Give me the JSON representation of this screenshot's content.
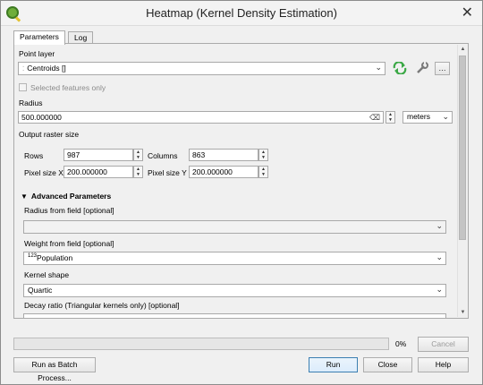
{
  "window": {
    "title": "Heatmap (Kernel Density Estimation)"
  },
  "tabs": [
    {
      "label": "Parameters",
      "active": true
    },
    {
      "label": "Log",
      "active": false
    }
  ],
  "point_layer": {
    "label": "Point layer",
    "value": "Centroids []",
    "selected_features_label": "Selected features only"
  },
  "radius": {
    "label": "Radius",
    "value": "500.000000",
    "unit": "meters"
  },
  "output_raster_size": {
    "label": "Output raster size",
    "rows_label": "Rows",
    "rows": "987",
    "columns_label": "Columns",
    "columns": "863",
    "pixel_x_label": "Pixel size X",
    "pixel_x": "200.000000",
    "pixel_y_label": "Pixel size Y",
    "pixel_y": "200.000000"
  },
  "advanced": {
    "header": "Advanced Parameters",
    "radius_field_label": "Radius from field [optional]",
    "radius_field_value": "",
    "weight_field_label": "Weight from field [optional]",
    "weight_field_type": "123",
    "weight_field_value": "Population",
    "kernel_label": "Kernel shape",
    "kernel_value": "Quartic",
    "decay_label": "Decay ratio (Triangular kernels only) [optional]"
  },
  "progress": {
    "percent": 0,
    "text": "0%"
  },
  "buttons": {
    "cancel": "Cancel",
    "batch": "Run as Batch Process...",
    "run": "Run",
    "close": "Close",
    "help": "Help"
  },
  "colors": {
    "icon_green": "#3aa845",
    "progress_fill": "#06b025"
  }
}
